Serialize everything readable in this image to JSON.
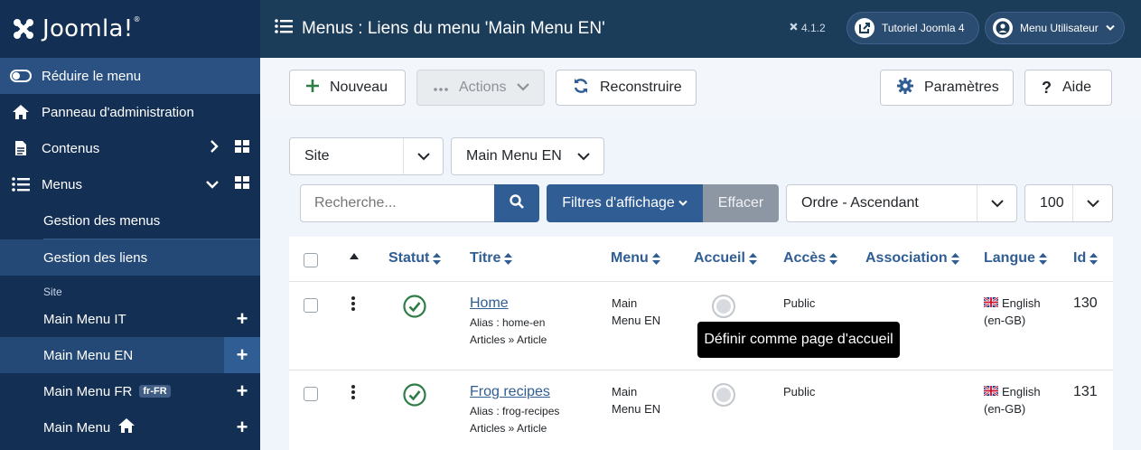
{
  "brand": {
    "name": "Joomla!"
  },
  "header": {
    "title": "Menus : Liens du menu 'Main Menu EN'",
    "version": "4.1.2",
    "tutorial_btn": "Tutoriel Joomla 4",
    "user_btn": "Menu Utilisateur"
  },
  "sidebar": {
    "toggle": "Réduire le menu",
    "panel": "Panneau d'administration",
    "content": "Contenus",
    "menus": "Menus",
    "manage_menus": "Gestion des menus",
    "manage_links": "Gestion des liens",
    "site_label": "Site",
    "menu_items": [
      {
        "label": "Main Menu IT"
      },
      {
        "label": "Main Menu EN"
      },
      {
        "label": "Main Menu FR",
        "badge": "fr-FR"
      },
      {
        "label": "Main Menu"
      }
    ]
  },
  "toolbar": {
    "new": "Nouveau",
    "actions": "Actions",
    "rebuild": "Reconstruire",
    "params": "Paramètres",
    "help": "Aide"
  },
  "filters": {
    "site": "Site",
    "menu": "Main Menu EN",
    "search_placeholder": "Recherche...",
    "filter_btn": "Filtres d'affichage",
    "clear_btn": "Effacer",
    "order": "Ordre - Ascendant",
    "limit": "100"
  },
  "table": {
    "headers": {
      "status": "Statut",
      "title": "Titre",
      "menu": "Menu",
      "home": "Accueil",
      "access": "Accès",
      "association": "Association",
      "language": "Langue",
      "id": "Id"
    },
    "rows": [
      {
        "title": "Home",
        "alias": "Alias : home-en",
        "type": "Articles » Article",
        "menu_line1": "Main",
        "menu_line2": "Menu EN",
        "access": "Public",
        "lang_line1": "English",
        "lang_line2": "(en-GB)",
        "id": "130"
      },
      {
        "title": "Frog recipes",
        "alias": "Alias : frog-recipes",
        "type": "Articles » Article",
        "menu_line1": "Main",
        "menu_line2": "Menu EN",
        "access": "Public",
        "lang_line1": "English",
        "lang_line2": "(en-GB)",
        "id": "131"
      }
    ]
  },
  "tooltip": "Définir comme page d'accueil",
  "colors": {
    "sidebar": "#132f53",
    "header": "#1c3d5a",
    "primary": "#2f5d94",
    "success": "#2e7d46"
  }
}
